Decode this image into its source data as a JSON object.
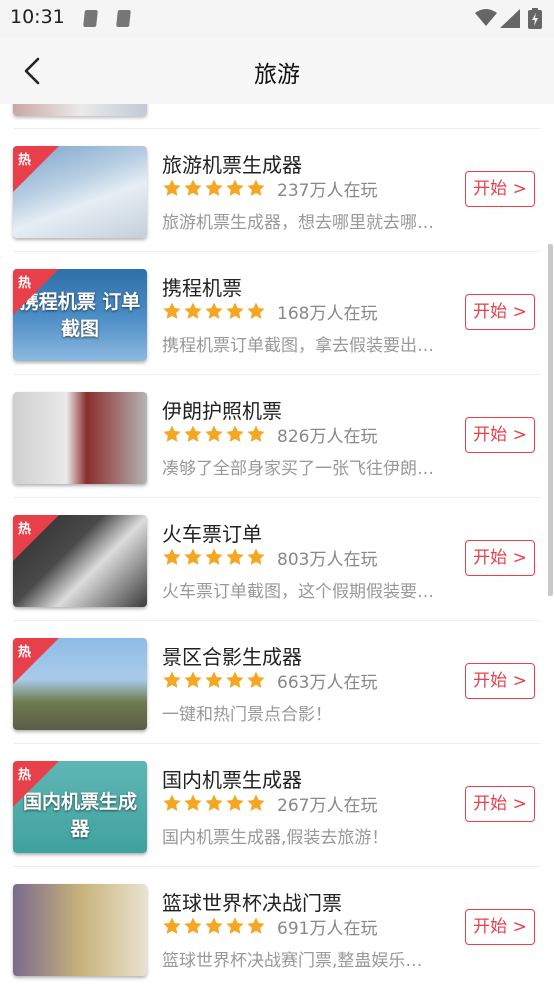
{
  "status": {
    "time": "10:31"
  },
  "header": {
    "title": "旅游"
  },
  "items": [
    {
      "title": "旅游机票生成器",
      "players": "237万人在玩",
      "desc": "旅游机票生成器，想去哪里就去哪…",
      "button": "开始 >",
      "hot": "热",
      "caption": ""
    },
    {
      "title": "携程机票",
      "players": "168万人在玩",
      "desc": "携程机票订单截图，拿去假装要出…",
      "button": "开始 >",
      "hot": "热",
      "caption": "携程机票 订单截图"
    },
    {
      "title": "伊朗护照机票",
      "players": "826万人在玩",
      "desc": "凑够了全部身家买了一张飞往伊朗…",
      "button": "开始 >",
      "hot": "",
      "caption": ""
    },
    {
      "title": "火车票订单",
      "players": "803万人在玩",
      "desc": "火车票订单截图，这个假期假装要…",
      "button": "开始 >",
      "hot": "热",
      "caption": ""
    },
    {
      "title": "景区合影生成器",
      "players": "663万人在玩",
      "desc": "一键和热门景点合影！",
      "button": "开始 >",
      "hot": "热",
      "caption": ""
    },
    {
      "title": "国内机票生成器",
      "players": "267万人在玩",
      "desc": "国内机票生成器,假装去旅游！",
      "button": "开始 >",
      "hot": "热",
      "caption": "国内机票生成器"
    },
    {
      "title": "篮球世界杯决战门票",
      "players": "691万人在玩",
      "desc": "篮球世界杯决战赛门票,整蛊娱乐…",
      "button": "开始 >",
      "hot": "",
      "caption": ""
    }
  ],
  "rating_stars": 5,
  "colors": {
    "accent": "#e8404b",
    "star": "#f5a623"
  }
}
